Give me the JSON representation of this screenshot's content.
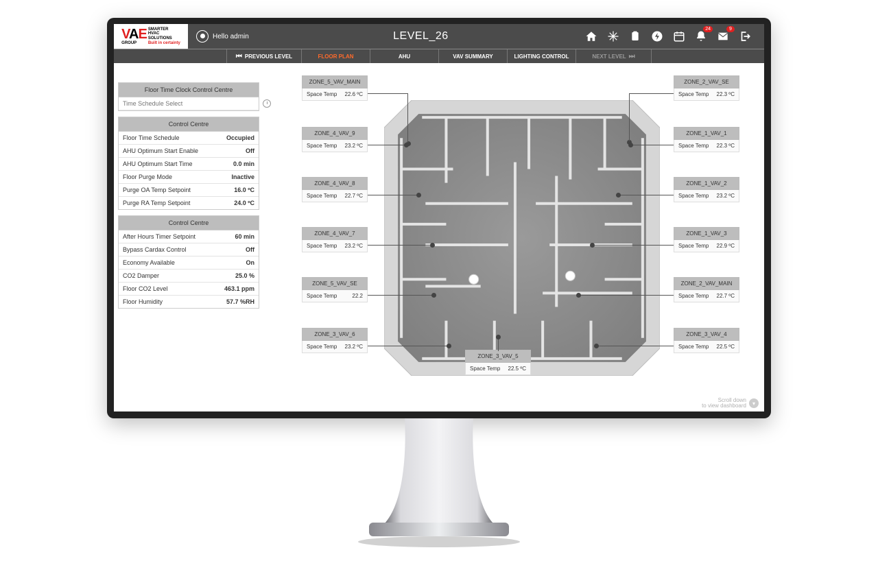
{
  "header": {
    "logo_group": "GROUP",
    "logo_tag1": "SMARTER",
    "logo_tag2": "HVAC",
    "logo_tag3": "SOLUTIONS",
    "logo_tag4": "Built in certainty",
    "greeting": "Hello admin",
    "title": "LEVEL_26",
    "badge_bell": "24",
    "badge_mail": "9"
  },
  "subnav": {
    "prev": "PREVIOUS LEVEL",
    "floorplan": "FLOOR PLAN",
    "ahu": "AHU",
    "vav": "VAV SUMMARY",
    "lighting": "LIGHTING CONTROL",
    "next": "NEXT LEVEL"
  },
  "panel1": {
    "title": "Floor Time Clock Control Centre",
    "schedule_placeholder": "Time Schedule Select"
  },
  "panel2": {
    "title": "Control Centre",
    "rows": [
      {
        "label": "Floor Time Schedule",
        "value": "Occupied"
      },
      {
        "label": "AHU Optimum Start Enable",
        "value": "Off"
      },
      {
        "label": "AHU Optimum Start Time",
        "value": "0.0 min"
      },
      {
        "label": "Floor Purge Mode",
        "value": "Inactive"
      },
      {
        "label": "Purge OA Temp Setpoint",
        "value": "16.0 ºC"
      },
      {
        "label": "Purge RA Temp Setpoint",
        "value": "24.0 ºC"
      }
    ]
  },
  "panel3": {
    "title": "Control Centre",
    "rows": [
      {
        "label": "After Hours Timer Setpoint",
        "value": "60 min"
      },
      {
        "label": "Bypass Cardax Control",
        "value": "Off"
      },
      {
        "label": "Economy Available",
        "value": "On"
      },
      {
        "label": "CO2 Damper",
        "value": "25.0 %"
      },
      {
        "label": "Floor CO2 Level",
        "value": "463.1 ppm"
      },
      {
        "label": "Floor Humidity",
        "value": "57.7 %RH"
      }
    ]
  },
  "zones_left": [
    {
      "name": "ZONE_5_VAV_MAIN",
      "label": "Space Temp",
      "val": "22.6 ºC"
    },
    {
      "name": "ZONE_4_VAV_9",
      "label": "Space Temp",
      "val": "23.2 ºC"
    },
    {
      "name": "ZONE_4_VAV_8",
      "label": "Space Temp",
      "val": "22.7 ºC"
    },
    {
      "name": "ZONE_4_VAV_7",
      "label": "Space Temp",
      "val": "23.2 ºC"
    },
    {
      "name": "ZONE_5_VAV_SE",
      "label": "Space Temp",
      "val": "22.2"
    },
    {
      "name": "ZONE_3_VAV_6",
      "label": "Space Temp",
      "val": "23.2 ºC"
    }
  ],
  "zones_bottom": [
    {
      "name": "ZONE_3_VAV_5",
      "label": "Space Temp",
      "val": "22.5 ºC"
    }
  ],
  "zones_right": [
    {
      "name": "ZONE_2_VAV_SE",
      "label": "Space Temp",
      "val": "22.3 ºC"
    },
    {
      "name": "ZONE_1_VAV_1",
      "label": "Space Temp",
      "val": "22.3 ºC"
    },
    {
      "name": "ZONE_1_VAV_2",
      "label": "Space Temp",
      "val": "23.2 ºC"
    },
    {
      "name": "ZONE_1_VAV_3",
      "label": "Space Temp",
      "val": "22.9 ºC"
    },
    {
      "name": "ZONE_2_VAV_MAIN",
      "label": "Space Temp",
      "val": "22.7 ºC"
    },
    {
      "name": "ZONE_3_VAV_4",
      "label": "Space Temp",
      "val": "22.5 ºC"
    }
  ],
  "hint": {
    "line1": "Scroll down",
    "line2": "to view dashboard"
  }
}
